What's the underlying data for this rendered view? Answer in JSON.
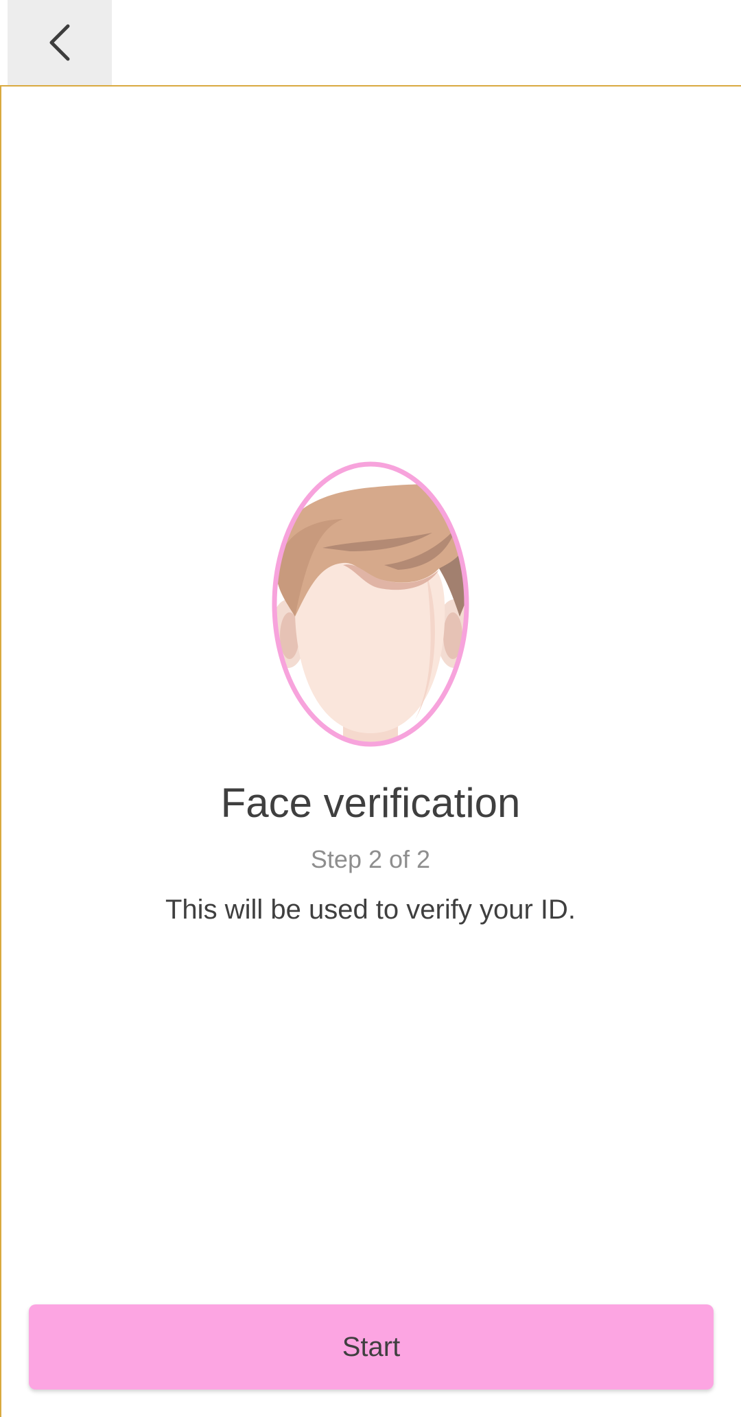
{
  "header": {
    "back_icon": "chevron-left-icon"
  },
  "main": {
    "illustration_icon": "face-outline-icon",
    "accent_color": "#f7a3dc",
    "title": "Face verification",
    "step": "Step 2 of 2",
    "description": "This will be used to verify your ID."
  },
  "footer": {
    "start_label": "Start",
    "button_color": "#fca5e2"
  }
}
